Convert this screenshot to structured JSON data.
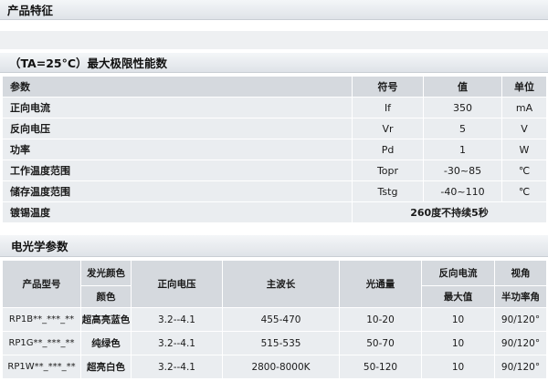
{
  "sections": {
    "features": "产品特征",
    "limits": "（TA=25°C）最大极限性能数",
    "electro": "电光学参数"
  },
  "limits_table": {
    "headers": [
      "参数",
      "符号",
      "值",
      "单位"
    ],
    "rows": [
      {
        "param": "正向电流",
        "symbol": "If",
        "value": "350",
        "unit": "mA"
      },
      {
        "param": "反向电压",
        "symbol": "Vr",
        "value": "5",
        "unit": "V"
      },
      {
        "param": "功率",
        "symbol": "Pd",
        "value": "1",
        "unit": "W"
      },
      {
        "param": "工作温度范围",
        "symbol": "Topr",
        "value": "-30~85",
        "unit": "℃"
      },
      {
        "param": "储存温度范围",
        "symbol": "Tstg",
        "value": "-40~110",
        "unit": "℃"
      }
    ],
    "solder_row": {
      "param": "镀锡温度",
      "note": "260度不持续5秒"
    }
  },
  "electro_table": {
    "headers": {
      "model": "产品型号",
      "color_top": "发光颜色",
      "color_bottom": "颜色",
      "forward_voltage": "正向电压",
      "wavelength": "主波长",
      "flux": "光通量",
      "reverse_current_top": "反向电流",
      "reverse_current_bottom": "最大值",
      "angle_top": "视角",
      "angle_bottom": "半功率角"
    },
    "rows": [
      {
        "model": "RP1B**_***_**",
        "color": "超高亮蓝色",
        "voltage": "3.2--4.1",
        "wavelength": "455-470",
        "flux": "10-20",
        "current": "10",
        "angle": "90/120°"
      },
      {
        "model": "RP1G**_***_**",
        "color": "纯绿色",
        "voltage": "3.2--4.1",
        "wavelength": "515-535",
        "flux": "50-70",
        "current": "10",
        "angle": "90/120°"
      },
      {
        "model": "RP1W**_***_**",
        "color": "超亮白色",
        "voltage": "3.2--4.1",
        "wavelength": "2800-8000K",
        "flux": "50-120",
        "current": "10",
        "angle": "90/120°"
      }
    ]
  }
}
